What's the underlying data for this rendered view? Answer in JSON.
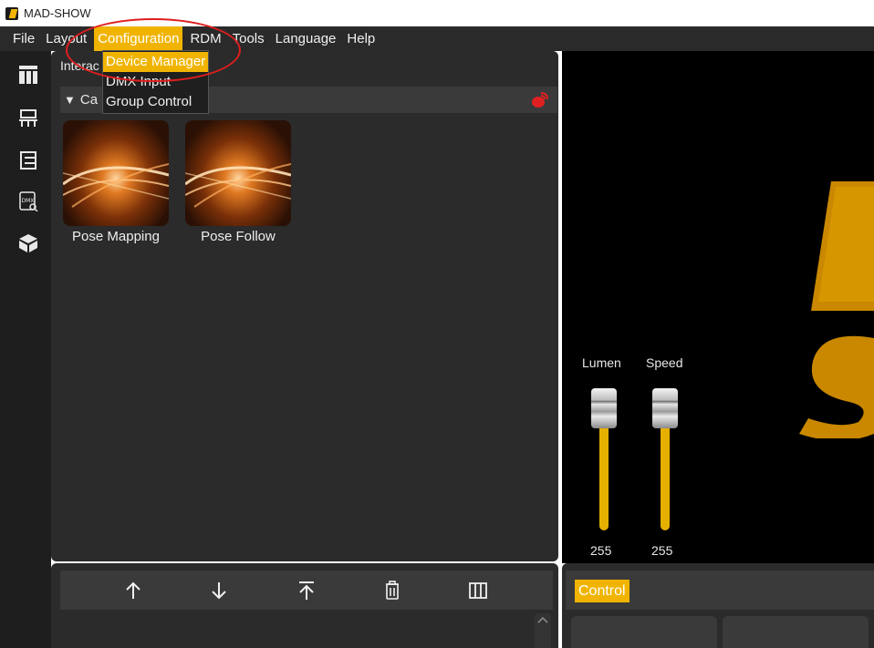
{
  "window": {
    "title": "MAD-SHOW"
  },
  "menubar": {
    "items": [
      "File",
      "Layout",
      "Configuration",
      "RDM",
      "Tools",
      "Language",
      "Help"
    ],
    "active": "Configuration"
  },
  "dropdown": {
    "items": [
      "Device Manager",
      "DMX Input",
      "Group Control"
    ],
    "hovered": "Device Manager"
  },
  "sidebar": {
    "icons": [
      "layout-icon",
      "device-tree-icon",
      "list-icon",
      "dmx-monitor-icon",
      "cube-icon"
    ]
  },
  "left_panel": {
    "tab_label": "Interac",
    "category_label": "Ca",
    "effects": [
      {
        "label": "Pose Mapping"
      },
      {
        "label": "Pose Follow"
      }
    ]
  },
  "faders": [
    {
      "label": "Lumen",
      "value": "255",
      "level": 1.0
    },
    {
      "label": "Speed",
      "value": "255",
      "level": 1.0
    }
  ],
  "bottom_right": {
    "control_tab": "Control"
  },
  "colors": {
    "accent": "#f0b400",
    "panel": "#2b2b2b",
    "annotation": "#e01e1e"
  }
}
